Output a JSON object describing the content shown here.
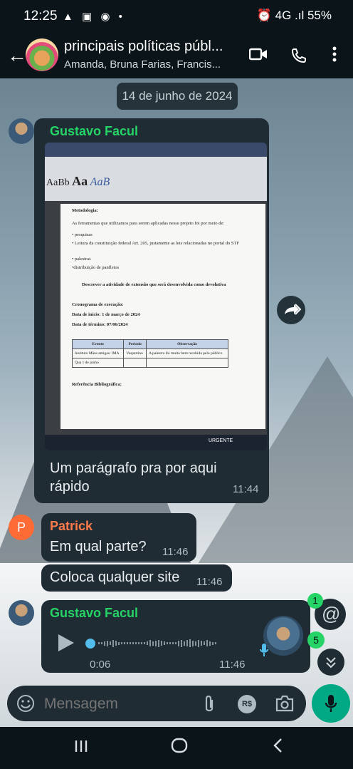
{
  "status_bar": {
    "time": "12:25",
    "left_icons": "▲ ▣ ◉ •",
    "right_text": "⏰ 4G .ıl 55%"
  },
  "header": {
    "title": "principais políticas públ...",
    "subtitle": "Amanda, Bruna Farias, Francis...",
    "icons": [
      "back-arrow-icon",
      "video-call-icon",
      "phone-icon",
      "more-vert-icon"
    ]
  },
  "date_chip": "14 de junho de 2024",
  "messages": [
    {
      "sender": "Gustavo Facul",
      "sender_color": "#25d366",
      "caption": "Um parágrafo pra por aqui rápido",
      "time": "11:44",
      "image_doc": {
        "heading": "Metodologia:",
        "intro": "As ferramentas que utilizamos para serem aplicadas nesse projeto foi por meio de:",
        "bullets": [
          "• pesquisas",
          "• Leitura da constituição federal Art. 205, justamente as leis relacionadas no portal do STF",
          "• palestras",
          "•distribuição de panfletos"
        ],
        "section": "Descrever a atividade de extensão que será desenvolvida como devolutiva",
        "schedule_title": "Cronograma de execução:",
        "start": "Data de início: 1 de março de 2024",
        "end": "Data de término: 07/06/2024",
        "table_headers": [
          "Evento",
          "Período",
          "Observação"
        ],
        "table_rows": [
          [
            "Instituto Mãos amigas: IMA",
            "Vespertino",
            "A palestra foi muito bem recebida pelo público"
          ],
          [
            "Qua 1 de junho",
            "",
            ""
          ]
        ],
        "references": "Referência Bibliográfica:",
        "taskbar_label": "URGENTE"
      }
    },
    {
      "sender": "Patrick",
      "sender_color": "#ff7a4a",
      "avatar_letter": "P",
      "text": "Em qual parte?",
      "time": "11:46"
    },
    {
      "text": "Coloca qualquer site",
      "time": "11:46"
    },
    {
      "sender": "Gustavo Facul",
      "sender_color": "#25d366",
      "voice_duration": "0:06",
      "time": "11:46"
    }
  ],
  "badges": {
    "mention_count": "1",
    "unread_count": "5"
  },
  "composer": {
    "placeholder": "Mensagem"
  },
  "icons": {
    "emoji": "emoji-icon",
    "attach": "attach-icon",
    "payment": "R$",
    "camera": "camera-icon",
    "mic": "mic-icon"
  },
  "nav": [
    "recent-apps-icon",
    "home-icon",
    "back-icon"
  ]
}
